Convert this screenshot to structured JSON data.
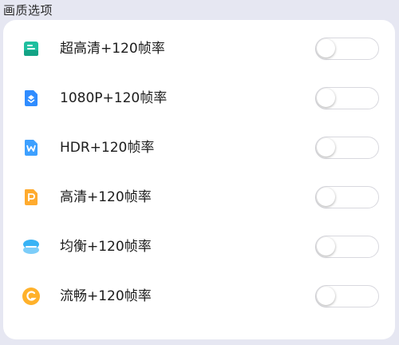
{
  "header": {
    "title": "画质选项"
  },
  "options": [
    {
      "label": "超高清+120帧率",
      "icon": "ultra-hd-icon",
      "color": "#1fbf9f",
      "enabled": false
    },
    {
      "label": "1080P+120帧率",
      "icon": "1080p-icon",
      "color": "#2f8cff",
      "enabled": false
    },
    {
      "label": "HDR+120帧率",
      "icon": "hdr-icon",
      "color": "#3da0ff",
      "enabled": false
    },
    {
      "label": "高清+120帧率",
      "icon": "hd-icon",
      "color": "#ffab2e",
      "enabled": false
    },
    {
      "label": "均衡+120帧率",
      "icon": "balanced-icon",
      "color": "#38b3f5",
      "enabled": false
    },
    {
      "label": "流畅+120帧率",
      "icon": "smooth-icon",
      "color": "#ffb12a",
      "enabled": false
    }
  ]
}
